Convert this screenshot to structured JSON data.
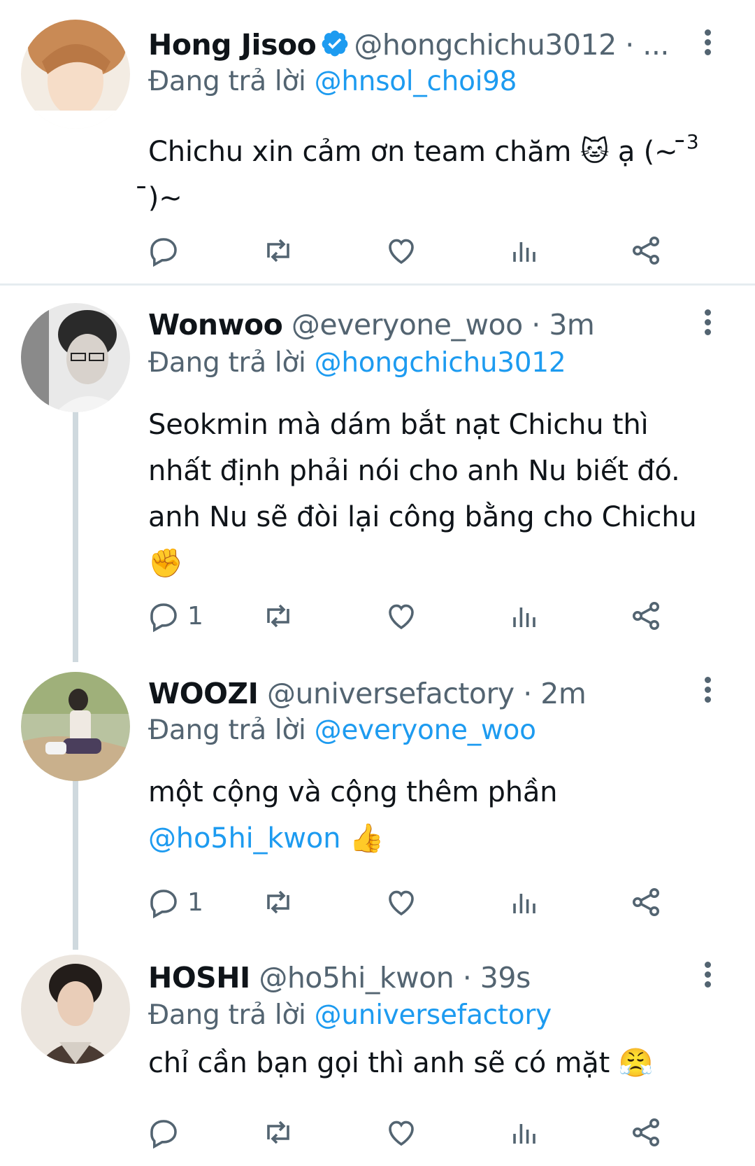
{
  "tweets": [
    {
      "name": "Hong Jisoo",
      "verified": true,
      "handle": "@hongchichu3012",
      "meta": " · ...",
      "reply_prefix": "Đang trả lời ",
      "reply_to": "@hnsol_choi98",
      "text_1": "Chichu xin cảm ơn team chăm ",
      "emoji_1": "🐱",
      "text_2": " ạ (~ ̄",
      "sup": "3",
      "text_3": " ̄)~",
      "reply_count": "",
      "avatar_colors": [
        "#caa078",
        "#f2e2cf"
      ]
    },
    {
      "name": "Wonwoo",
      "handle": "@everyone_woo",
      "meta": " · 3m",
      "reply_prefix": "Đang trả lời ",
      "reply_to": "@hongchichu3012",
      "text_1": "Seokmin mà dám bắt nạt Chichu thì nhất định phải nói cho anh Nu biết đó. anh Nu sẽ đòi lại công bằng cho Chichu",
      "emoji_1": "✊",
      "reply_count": "1",
      "avatar_colors": [
        "#6e6e6e",
        "#d9d9d9"
      ]
    },
    {
      "name": "WOOZI",
      "handle": "@universefactory",
      "meta": " · 2m",
      "reply_prefix": "Đang trả lời ",
      "reply_to": "@everyone_woo",
      "text_1": "một cộng và cộng thêm phần",
      "mention": "@ho5hi_kwon",
      "emoji_1": "👍",
      "reply_count": "1",
      "avatar_colors": [
        "#8a9a6a",
        "#d8c7a5"
      ]
    },
    {
      "name": "HOSHI",
      "handle": "@ho5hi_kwon",
      "meta": " · 39s",
      "reply_prefix": "Đang trả lời ",
      "reply_to": "@universefactory",
      "text_1": "chỉ cần bạn gọi thì anh sẽ có mặt ",
      "emoji_1": "😤",
      "reply_count": "",
      "avatar_colors": [
        "#3a2f2a",
        "#e8e0d8"
      ]
    }
  ],
  "icons": {
    "reply": "reply-icon",
    "retweet": "retweet-icon",
    "like": "heart-icon",
    "analytics": "analytics-icon",
    "share": "share-icon",
    "more": "more-vertical-icon",
    "verified": "verified-badge-icon"
  },
  "colors": {
    "accent": "#1d9bf0",
    "secondary": "#536471",
    "text": "#0f1419"
  }
}
